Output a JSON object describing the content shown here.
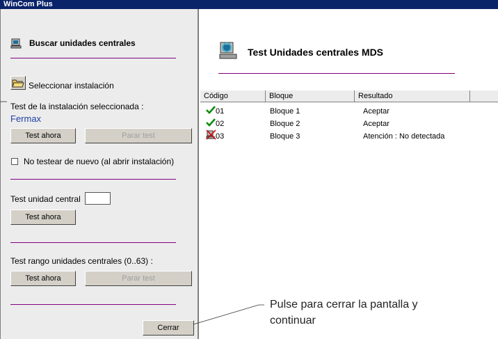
{
  "window": {
    "title": "WinCom Plus"
  },
  "left_panel": {
    "search_title": "Buscar unidades centrales",
    "select_install_label": "Seleccionar instalación",
    "test_selected_label": "Test de la instalación seleccionada :",
    "installation_name": "Fermax",
    "test_now": "Test ahora",
    "stop_test": "Parar test",
    "no_retest_label": "No testear de nuevo (al abrir instalación)",
    "test_unit_label": "Test unidad central",
    "test_unit_value": "",
    "test_range_label": "Test rango unidades centrales (0..63) :",
    "close_label": "Cerrar"
  },
  "right_panel": {
    "title": "Test Unidades centrales MDS",
    "columns": [
      "Código",
      "Bloque",
      "Resultado"
    ],
    "rows": [
      {
        "code": "01",
        "block": "Bloque 1",
        "result": "Aceptar",
        "status_icon": "check-icon"
      },
      {
        "code": "02",
        "block": "Bloque 2",
        "result": "Aceptar",
        "status_icon": "check-icon"
      },
      {
        "code": "03",
        "block": "Bloque 3",
        "result": "Atención : No detectada",
        "status_icon": "error-icon"
      }
    ]
  },
  "annotation": {
    "line1": "Pulse para cerrar la pantalla y",
    "line2": "continuar"
  },
  "colors": {
    "titlebar": "#0a246a",
    "divider": "#800080",
    "link": "#1f3fa6"
  }
}
